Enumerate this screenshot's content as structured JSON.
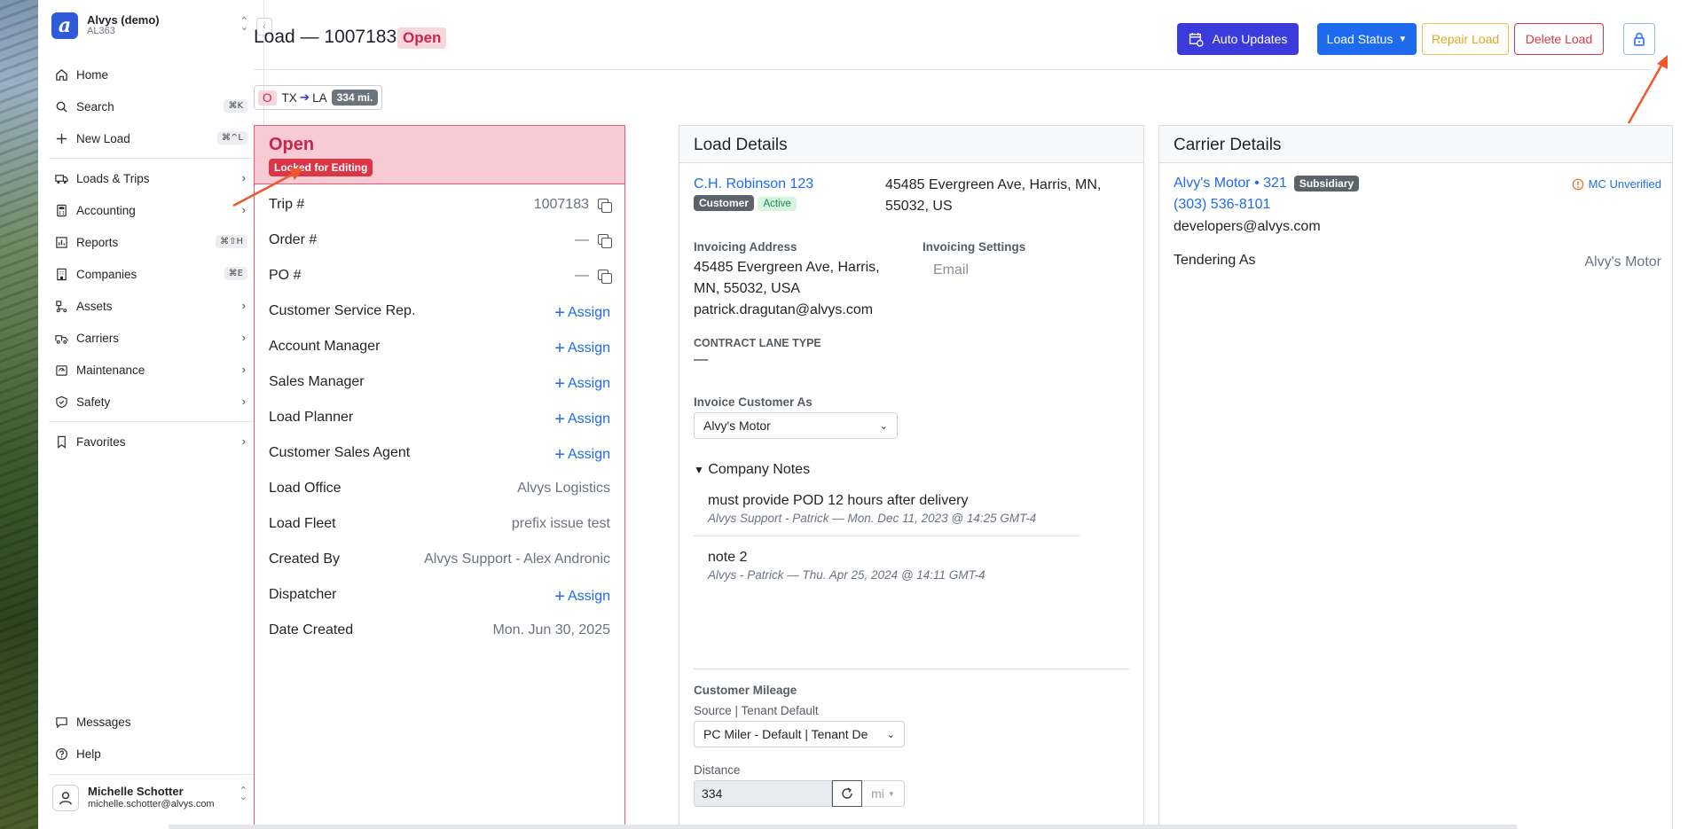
{
  "org": {
    "name": "Alvys (demo)",
    "code": "AL363",
    "logo_letter": "a"
  },
  "sidebar": {
    "items": [
      {
        "label": "Home",
        "icon": "home-icon"
      },
      {
        "label": "Search",
        "icon": "search-icon",
        "shortcut": "⌘K"
      },
      {
        "label": "New Load",
        "icon": "plus-icon",
        "shortcut": "⌘^L"
      },
      {
        "label": "Loads & Trips",
        "icon": "truck-icon"
      },
      {
        "label": "Accounting",
        "icon": "calculator-icon"
      },
      {
        "label": "Reports",
        "icon": "report-icon",
        "shortcut": "⌘⇧H"
      },
      {
        "label": "Companies",
        "icon": "building-icon",
        "shortcut": "⌘E"
      },
      {
        "label": "Assets",
        "icon": "assets-icon"
      },
      {
        "label": "Carriers",
        "icon": "carrier-icon"
      },
      {
        "label": "Maintenance",
        "icon": "wrench-icon"
      },
      {
        "label": "Safety",
        "icon": "shield-icon"
      },
      {
        "label": "Favorites",
        "icon": "bookmark-icon"
      },
      {
        "label": "Messages",
        "icon": "message-icon"
      },
      {
        "label": "Help",
        "icon": "help-icon"
      }
    ]
  },
  "user": {
    "name": "Michelle Schotter",
    "email": "michelle.schotter@alvys.com"
  },
  "header": {
    "title": "Load — 1007183",
    "status": "Open",
    "buttons": {
      "auto_updates": "Auto Updates",
      "load_status": "Load Status",
      "repair": "Repair Load",
      "delete": "Delete Load"
    }
  },
  "route": {
    "status_letter": "O",
    "from": "TX",
    "to": "LA",
    "miles": "334 mi."
  },
  "status_panel": {
    "title": "Open",
    "lock_badge": "Locked for Editing",
    "assign_label": "Assign",
    "rows": {
      "trip": {
        "label": "Trip #",
        "value": "1007183"
      },
      "order": {
        "label": "Order #",
        "value": "—"
      },
      "po": {
        "label": "PO #",
        "value": "—"
      },
      "csr": {
        "label": "Customer Service Rep."
      },
      "account_manager": {
        "label": "Account Manager"
      },
      "sales_manager": {
        "label": "Sales Manager"
      },
      "load_planner": {
        "label": "Load Planner"
      },
      "sales_agent": {
        "label": "Customer Sales Agent"
      },
      "office": {
        "label": "Load Office",
        "value": "Alvys Logistics"
      },
      "fleet": {
        "label": "Load Fleet",
        "value": "prefix issue test"
      },
      "created_by": {
        "label": "Created By",
        "value": "Alvys Support - Alex Andronic"
      },
      "dispatcher": {
        "label": "Dispatcher"
      },
      "date_created": {
        "label": "Date Created",
        "value": "Mon. Jun 30, 2025"
      }
    }
  },
  "load_details": {
    "title": "Load Details",
    "customer": "C.H. Robinson 123",
    "customer_tag": "Customer",
    "active_tag": "Active",
    "customer_address": "45485 Evergreen Ave, Harris, MN, 55032, US",
    "invoicing_address_label": "Invoicing Address",
    "invoicing_address": "45485 Evergreen Ave, Harris, MN, 55032, USA",
    "invoicing_email": "patrick.dragutan@alvys.com",
    "invoicing_settings_label": "Invoicing Settings",
    "invoicing_settings_value": "Email",
    "contract_lane_label": "CONTRACT LANE TYPE",
    "contract_lane_value": "—",
    "invoice_as_label": "Invoice Customer As",
    "invoice_as_value": "Alvy's Motor",
    "notes_label": "Company Notes",
    "notes": [
      {
        "text": "must provide POD 12 hours after delivery",
        "meta": "Alvys Support - Patrick — Mon. Dec 11, 2023 @ 14:25 GMT-4"
      },
      {
        "text": "note 2",
        "meta": "Alvys - Patrick — Thu. Apr 25, 2024 @ 14:11 GMT-4"
      }
    ],
    "mileage_label": "Customer Mileage",
    "source_label": "Source | Tenant Default",
    "source_value": "PC Miler - Default | Tenant De",
    "distance_label": "Distance",
    "distance_value": "334",
    "unit": "mi"
  },
  "carrier": {
    "title": "Carrier Details",
    "name": "Alvy's Motor • 321",
    "tag": "Subsidiary",
    "mc_status": "MC Unverified",
    "phone": "(303) 536-8101",
    "email": "developers@alvys.com",
    "tendering_label": "Tendering As",
    "tendering_value": "Alvy's Motor"
  },
  "colors": {
    "primary": "#1f6bf0",
    "auto_updates": "#3b3bdc",
    "danger": "#dc3545",
    "warning": "#f0c24a",
    "open_bg": "#f6cbd3",
    "annotation_arrow": "#f0582a"
  }
}
